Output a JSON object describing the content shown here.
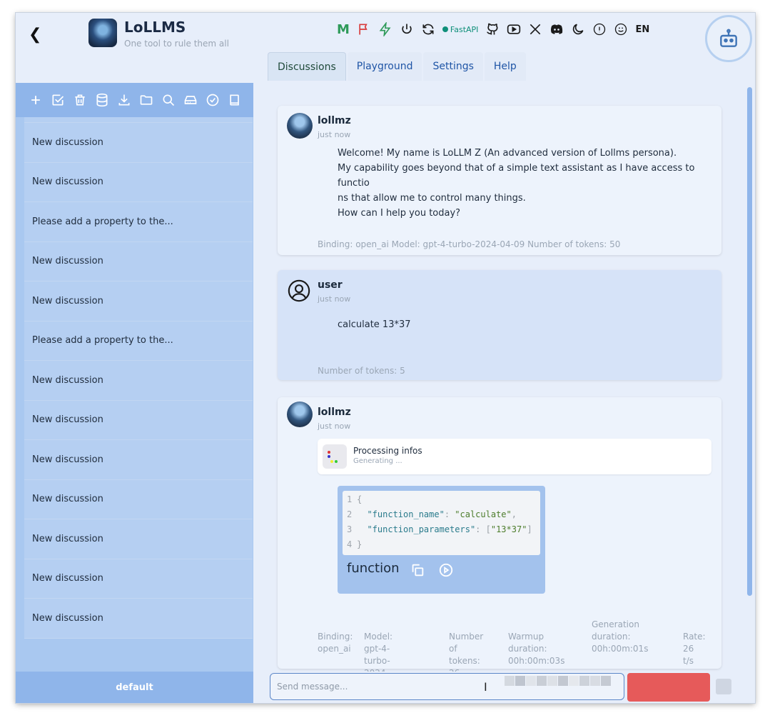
{
  "header": {
    "app_title": "LoLLMS",
    "app_subtitle": "One tool to rule them all",
    "toolbar": {
      "m_label": "M",
      "fastapi_label": "FastAPI",
      "lang_label": "EN"
    },
    "icons": [
      "back-icon",
      "m-icon",
      "flag-icon",
      "bolt-icon",
      "power-icon",
      "refresh-icon",
      "fastapi-icon",
      "github-icon",
      "youtube-icon",
      "x-icon",
      "discord-icon",
      "moon-icon",
      "info-icon",
      "smiley-icon",
      "language-label",
      "robot-icon"
    ]
  },
  "tabs": [
    {
      "label": "Discussions",
      "active": true
    },
    {
      "label": "Playground",
      "active": false
    },
    {
      "label": "Settings",
      "active": false
    },
    {
      "label": "Help",
      "active": false
    }
  ],
  "sidebar": {
    "toolbar_icons": [
      "add-icon",
      "check-square-icon",
      "trash-icon",
      "database-icon",
      "download-icon",
      "folder-icon",
      "search-icon",
      "storage-icon",
      "check-circle-icon",
      "book-icon"
    ],
    "discussions": [
      "New discussion",
      "New discussion",
      "New discussion",
      "Please add a property to the...",
      "New discussion",
      "New discussion",
      "Please add a property to the...",
      "New discussion",
      "New discussion",
      "New discussion",
      "New discussion",
      "New discussion",
      "New discussion",
      "New discussion"
    ],
    "footer_label": "default"
  },
  "messages": [
    {
      "sender": "lollmz",
      "time": "just now",
      "lines": [
        "Welcome! My name is LoLLM Z (An advanced version of Lollms persona).",
        "My capability goes beyond that of a simple text assistant as I have access to functio",
        "ns that allow me to control many things.",
        "How can I help you today?"
      ],
      "meta": "Binding: open_ai  Model: gpt-4-turbo-2024-04-09  Number of tokens: 50"
    },
    {
      "sender": "user",
      "time": "just now",
      "lines": [
        "calculate 13*37"
      ],
      "meta": "Number of tokens: 5"
    },
    {
      "sender": "lollmz",
      "time": "just now",
      "processing": {
        "title": "Processing infos",
        "status": "Generating ..."
      },
      "code": {
        "lines": [
          {
            "n": "1",
            "text": "{"
          },
          {
            "n": "2",
            "key": "\"function_name\"",
            "value": "\"calculate\"",
            "trail": ","
          },
          {
            "n": "3",
            "key": "\"function_parameters\"",
            "value": "\"13*37\"",
            "array": true
          },
          {
            "n": "4",
            "text": "}"
          }
        ],
        "label": "function"
      },
      "meta": {
        "binding_label": "Binding:",
        "binding_value": "open_ai",
        "model_label": "Model: gpt-4-",
        "model_value": "turbo-2024-04-09",
        "tokens_label": "Number of",
        "tokens_value": "tokens: 26",
        "warmup_label": "Warmup duration:",
        "warmup_value": "00h:00m:03s",
        "gen_label1": "Generation",
        "gen_label2": "duration:",
        "gen_value": "00h:00m:01s",
        "rate_label": "Rate:",
        "rate_value": "26 t/s"
      }
    }
  ],
  "input": {
    "placeholder": "Send message..."
  },
  "colors": {
    "sidebar": "#a9c8f0",
    "sidebar_toolbar": "#8fb5ea",
    "send_button": "#e65a5a"
  }
}
